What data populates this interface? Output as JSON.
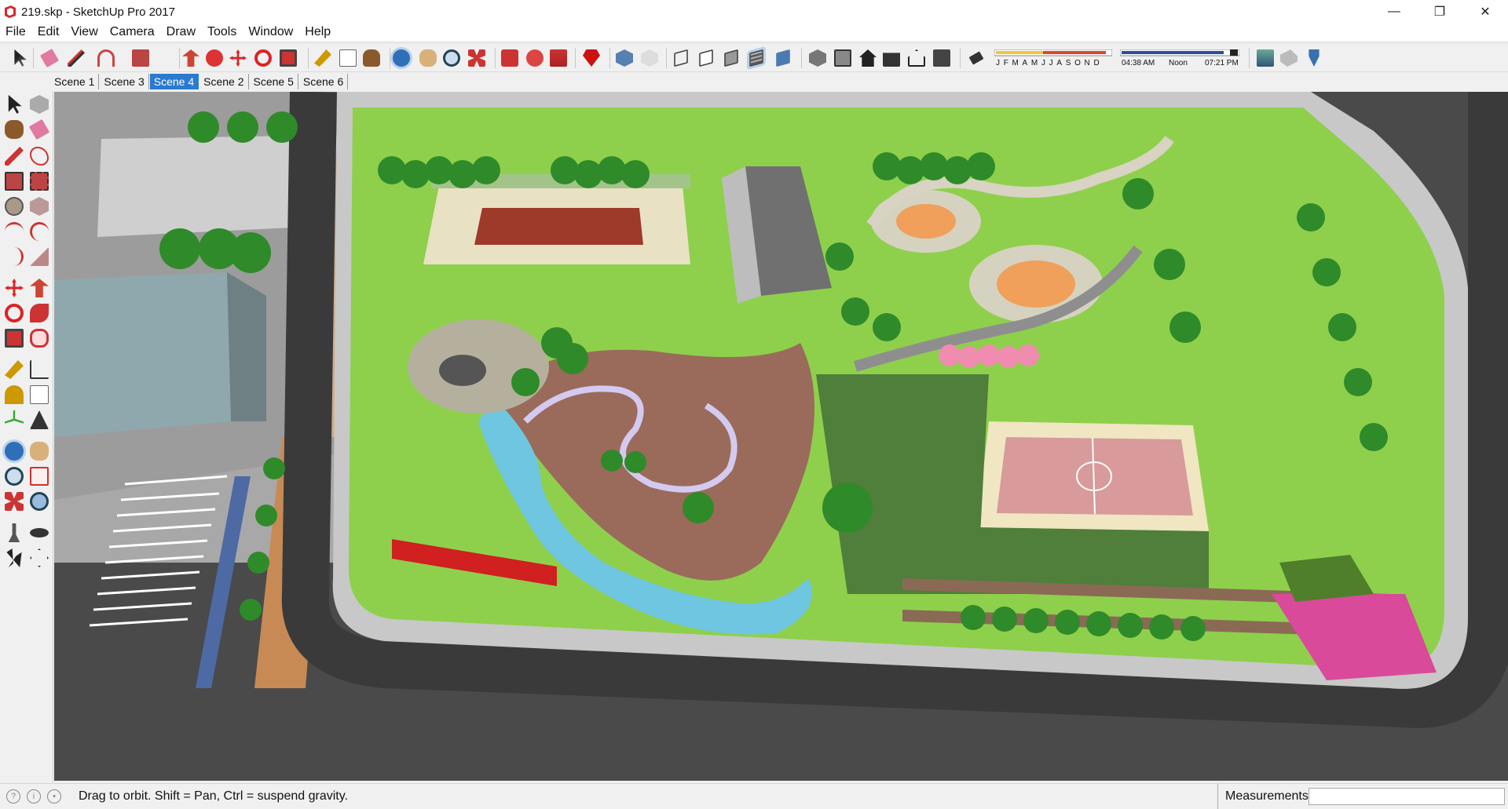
{
  "window": {
    "title": "219.skp - SketchUp Pro 2017",
    "minimize_glyph": "—",
    "maximize_glyph": "❐",
    "close_glyph": "✕"
  },
  "menu": [
    "File",
    "Edit",
    "View",
    "Camera",
    "Draw",
    "Tools",
    "Window",
    "Help"
  ],
  "shadow_panel": {
    "months": "JFMAMJJASOND",
    "time_start": "04:38 AM",
    "time_mid": "Noon",
    "time_end": "07:21 PM"
  },
  "scenes": [
    "Scene 1",
    "Scene 3",
    "Scene 4",
    "Scene 2",
    "Scene 5",
    "Scene 6"
  ],
  "active_scene": "Scene 4",
  "status": {
    "hint": "Drag to orbit. Shift = Pan, Ctrl = suspend gravity.",
    "measurements_label": "Measurements",
    "measurements_value": ""
  },
  "toolbar_icons": [
    "select-icon",
    "eraser-icon",
    "pencil-icon",
    "arc-icon",
    "shape-icon",
    "push-pull-icon",
    "follow-me-icon",
    "move-icon",
    "rotate-icon",
    "scale-icon",
    "tape-measure-icon",
    "text-icon",
    "paint-bucket-icon",
    "orbit-icon",
    "pan-icon",
    "zoom-icon",
    "zoom-extents-icon",
    "warehouse-icon",
    "extension-warehouse-icon",
    "layout-icon",
    "ruby-icon",
    "xray-icon",
    "back-edges-icon",
    "wireframe-icon",
    "hidden-line-icon",
    "shaded-icon",
    "shaded-textures-icon",
    "monochrome-icon",
    "iso-view-icon",
    "top-view-icon",
    "front-view-icon",
    "right-view-icon",
    "back-view-icon",
    "left-view-icon",
    "shadows-toggle-icon",
    "fog-icon",
    "sandbox-icon",
    "geo-location-icon"
  ],
  "colors": {
    "accent": "#2a7ad0",
    "grass": "#8ed04c",
    "road": "#3b3b3b",
    "water": "#6ec6e0",
    "plaza": "#9a6b5a",
    "court": "#d89a9a"
  }
}
